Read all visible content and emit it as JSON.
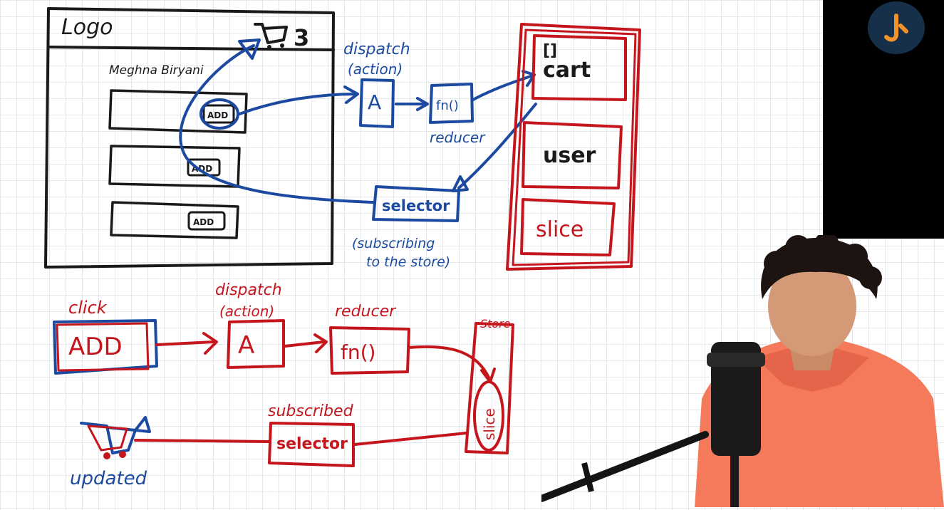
{
  "top_diagram": {
    "app_logo": "Logo",
    "cart_count": "3",
    "user_name": "Meghna Biryani",
    "add_buttons": [
      "ADD",
      "ADD",
      "ADD"
    ],
    "dispatch_label": "dispatch",
    "action_label": "(action)",
    "action_box": "A",
    "reducer_fn": "fn()",
    "reducer_label": "reducer",
    "selector_box": "selector",
    "subscribing_line1": "(subscribing",
    "subscribing_line2": "to the store)",
    "store_icon": "[]",
    "store_slices": [
      "cart",
      "user",
      "slice"
    ]
  },
  "bottom_flow": {
    "click_label": "click",
    "add_box": "ADD",
    "dispatch_label": "dispatch",
    "action_label": "(action)",
    "action_box": "A",
    "reducer_label": "reducer",
    "reducer_fn": "fn()",
    "store_label": "Store",
    "slice_label": "slice",
    "subscribed_label": "subscribed",
    "selector_box": "selector",
    "updated_label": "updated"
  },
  "colors": {
    "ink_black": "#1a1a1a",
    "ink_blue": "#1b4aa0",
    "ink_red": "#c4161c",
    "grid": "#e4e8ec",
    "logo_bg": "#163049",
    "logo_accent": "#f2922a"
  },
  "icons": [
    "cart-icon",
    "logo-icon"
  ]
}
